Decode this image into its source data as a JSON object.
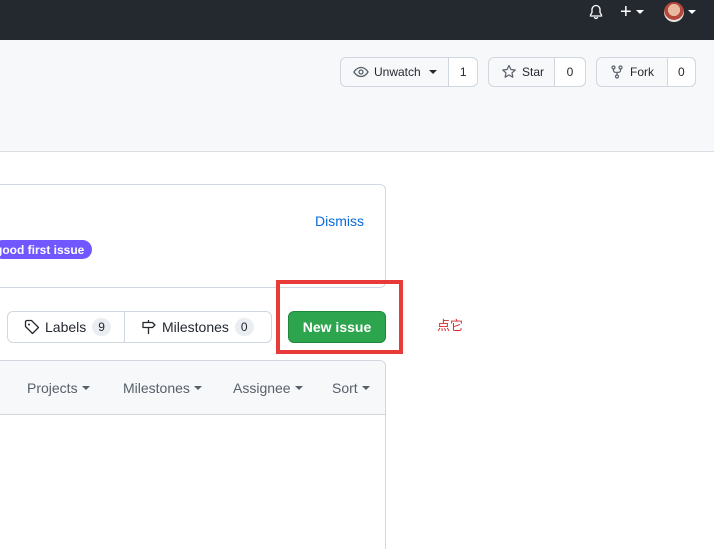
{
  "header": {
    "icons": [
      "bell-icon",
      "plus-icon",
      "avatar"
    ]
  },
  "repo_actions": {
    "watch_label": "Unwatch",
    "watch_count": "1",
    "star_label": "Star",
    "star_count": "0",
    "fork_label": "Fork",
    "fork_count": "0"
  },
  "banner": {
    "dismiss_label": "Dismiss",
    "label_pill": "good first issue"
  },
  "toolbar": {
    "labels_label": "Labels",
    "labels_count": "9",
    "milestones_label": "Milestones",
    "milestones_count": "0",
    "new_issue_label": "New issue"
  },
  "annotation": {
    "text": "点它",
    "color": "#e93a3a"
  },
  "filters": {
    "projects": "Projects",
    "milestones": "Milestones",
    "assignee": "Assignee",
    "sort": "Sort"
  },
  "colors": {
    "primary_green": "#2da44e",
    "header_dark": "#24292f",
    "label_purple": "#7057ff",
    "link_blue": "#0969da"
  }
}
